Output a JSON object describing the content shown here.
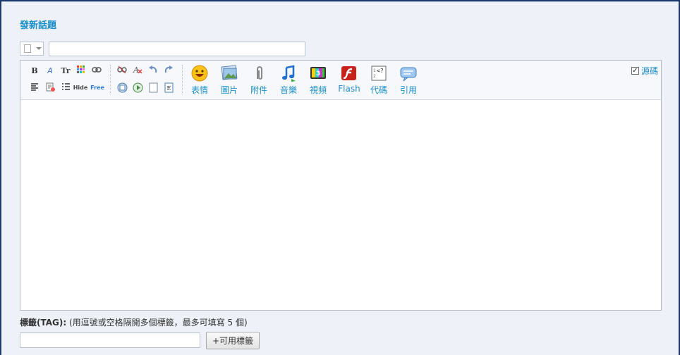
{
  "form": {
    "title": "發新話題",
    "subject_value": "",
    "tag_label_bold": "標籤(TAG):",
    "tag_label_hint": "(用逗號或空格隔開多個標籤，最多可填寫 5 個)",
    "tag_value": "",
    "tag_button": "+可用標籤"
  },
  "toolbar": {
    "source_label": "源碼",
    "source_checked": true,
    "small_row1": [
      "B",
      "A",
      "Tr",
      "::",
      "∞",
      "§",
      "A",
      "↶",
      "↷"
    ],
    "small_row2": [
      "≡",
      "▤",
      "☰",
      "Hide",
      "Free",
      "◎",
      "▶",
      "□",
      "E"
    ],
    "big_buttons": [
      {
        "label": "表情",
        "icon": "smiley-icon"
      },
      {
        "label": "圖片",
        "icon": "image-icon"
      },
      {
        "label": "附件",
        "icon": "paperclip-icon"
      },
      {
        "label": "音樂",
        "icon": "music-icon"
      },
      {
        "label": "視頻",
        "icon": "video-icon"
      },
      {
        "label": "Flash",
        "icon": "flash-icon"
      },
      {
        "label": "代碼",
        "icon": "code-icon"
      },
      {
        "label": "引用",
        "icon": "quote-icon"
      }
    ]
  },
  "colors": {
    "accent": "#1c8fc8",
    "panel": "#eef2f8",
    "frame": "#1e3a6b"
  }
}
